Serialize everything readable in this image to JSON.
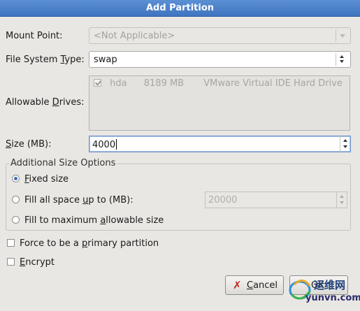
{
  "window": {
    "title": "Add Partition"
  },
  "mount_point": {
    "label_pre": "Mount Point:",
    "value": "<Not Applicable>"
  },
  "fs_type": {
    "label_pre": "File System ",
    "label_u": "T",
    "label_post": "ype:",
    "value": "swap"
  },
  "drives": {
    "label_pre": "Allowable ",
    "label_u": "D",
    "label_post": "rives:",
    "rows": [
      {
        "name": "hda",
        "size": "8189 MB",
        "model": "VMware Virtual IDE Hard Drive"
      }
    ]
  },
  "size": {
    "label_pre": "",
    "label_u": "S",
    "label_post": "ize (MB):",
    "value": "4000"
  },
  "size_options": {
    "title": "Additional Size Options",
    "fixed": {
      "pre": "",
      "u": "F",
      "post": "ixed size"
    },
    "fill_up_to": {
      "pre": "Fill all space ",
      "u": "u",
      "post": "p to (MB):",
      "value": "20000"
    },
    "fill_max": {
      "pre": "Fill to maximum ",
      "u": "a",
      "post": "llowable size"
    }
  },
  "primary": {
    "pre": "Force to be a ",
    "u": "p",
    "post": "rimary partition"
  },
  "encrypt": {
    "pre": "",
    "u": "E",
    "post": "ncrypt"
  },
  "buttons": {
    "cancel_u": "C",
    "cancel_post": "ancel",
    "ok_label": "OK"
  },
  "watermark": {
    "text": "yunvn.com",
    "brand": "运维网"
  }
}
